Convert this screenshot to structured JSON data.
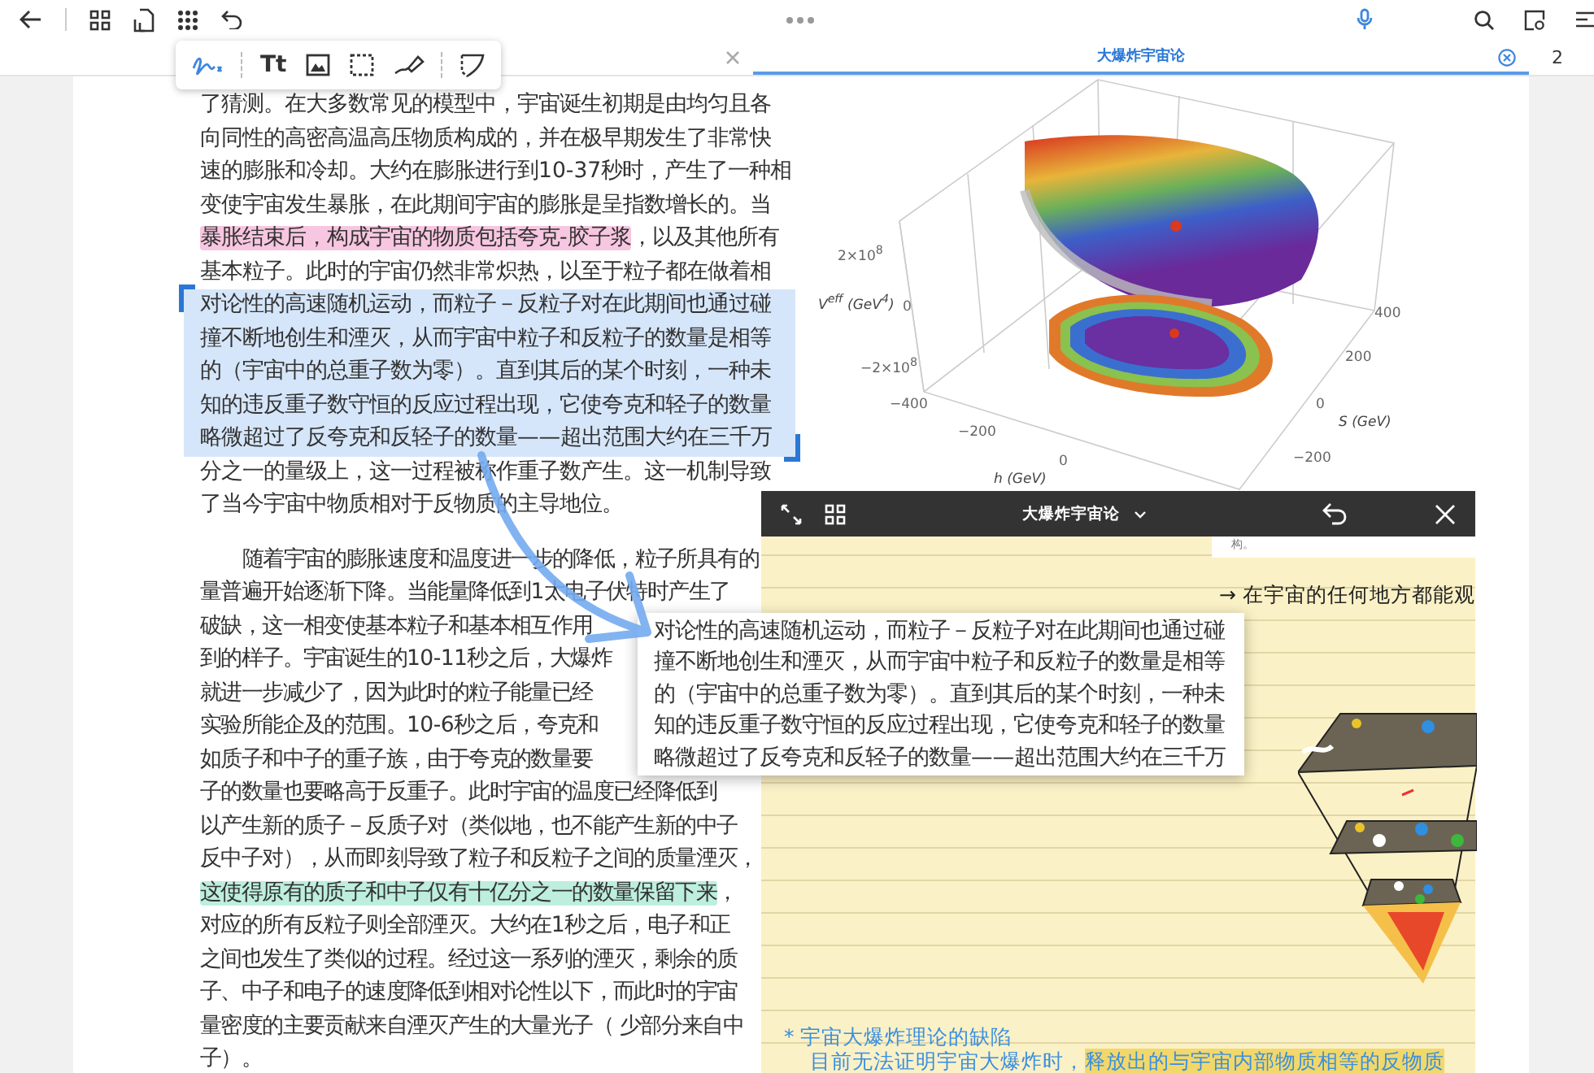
{
  "tabs": [
    {
      "label": "大爆炸宇宙论",
      "selected": true
    }
  ],
  "page_count": "2",
  "drawing_tools": [
    {
      "kind": "pen",
      "selected": true
    },
    {
      "kind": "text",
      "label": "Tt",
      "selected": false
    },
    {
      "kind": "image",
      "selected": false
    },
    {
      "kind": "select",
      "selected": false
    },
    {
      "kind": "highlighter",
      "selected": false
    },
    {
      "kind": "lasso",
      "selected": false
    }
  ],
  "document": {
    "paragraphs": [
      {
        "indent": false,
        "lines": [
          {
            "selected": false,
            "parts": [
              {
                "text": "了猜测。在大多数常见的模型中，宇宙诞生初期是由均匀且各"
              }
            ]
          },
          {
            "selected": false,
            "parts": [
              {
                "text": "向同性的高密高温高压物质构成的，并在极早期发生了非常快"
              }
            ]
          },
          {
            "selected": false,
            "parts": [
              {
                "text": "速的膨胀和冷却。大约在膨胀进行到10-37秒时，产生了一种相"
              }
            ]
          },
          {
            "selected": false,
            "parts": [
              {
                "text": "变使宇宙发生暴胀，在此期间宇宙的膨胀是呈指数增长的。当"
              }
            ]
          },
          {
            "selected": false,
            "parts": [
              {
                "text": "暴胀结束后，构成宇宙的物质包括夸克-胶子浆",
                "color": "#f7c6e0"
              },
              {
                "text": "，以及其他所有"
              }
            ]
          },
          {
            "selected": false,
            "parts": [
              {
                "text": "基本粒子。此时的宇宙仍然非常炽热，以至于粒子都在做着相"
              }
            ]
          },
          {
            "selected": true,
            "parts": [
              {
                "text": "对论性的高速随机运动，而粒子－反粒子对在此期间也通过碰"
              }
            ]
          },
          {
            "selected": true,
            "parts": [
              {
                "text": "撞不断地创生和湮灭，从而宇宙中粒子和反粒子的数量是相等"
              }
            ]
          },
          {
            "selected": true,
            "parts": [
              {
                "text": "的（宇宙中的总重子数为零）。直到其后的某个时刻，一种未"
              }
            ]
          },
          {
            "selected": true,
            "parts": [
              {
                "text": "知的违反重子数守恒的反应过程出现，它使夸克和轻子的数量"
              }
            ]
          },
          {
            "selected": true,
            "parts": [
              {
                "text": "略微超过了反夸克和反轻子的数量——超出范围大约在三千万"
              }
            ]
          },
          {
            "selected": false,
            "parts": [
              {
                "text": "分之一的量级上，这一过程被称作重子数产生。这一机制导致"
              }
            ]
          },
          {
            "selected": false,
            "parts": [
              {
                "text": "了当今宇宙中物质相对于反物质的主导地位。"
              }
            ]
          }
        ]
      },
      {
        "indent": true,
        "lines": [
          {
            "selected": false,
            "parts": [
              {
                "text": "随着宇宙的膨胀速度和温度进一步的降低，粒子所具有的"
              }
            ]
          },
          {
            "selected": false,
            "parts": [
              {
                "text": "量普遍开始逐渐下降。当能量降低到1太电子伏特时产生了"
              }
            ]
          },
          {
            "selected": false,
            "parts": [
              {
                "text": "破缺，这一相变使基本粒子和基本相互作用"
              }
            ]
          },
          {
            "selected": false,
            "parts": [
              {
                "text": "到的样子。宇宙诞生的10-11秒之后，大爆炸"
              }
            ]
          },
          {
            "selected": false,
            "parts": [
              {
                "text": "就进一步减少了，因为此时的粒子能量已经"
              }
            ]
          },
          {
            "selected": false,
            "parts": [
              {
                "text": "实验所能企及的范围。10-6秒之后，夸克和"
              }
            ]
          },
          {
            "selected": false,
            "parts": [
              {
                "text": "如质子和中子的重子族，由于夸克的数量要"
              }
            ]
          },
          {
            "selected": false,
            "parts": [
              {
                "text": "子的数量也要略高于反重子。此时宇宙的温度已经降低到"
              }
            ]
          },
          {
            "selected": false,
            "parts": [
              {
                "text": "以产生新的质子－反质子对（类似地，也不能产生新的中子"
              }
            ]
          },
          {
            "selected": false,
            "parts": [
              {
                "text": "反中子对），从而即刻导致了粒子和反粒子之间的质量湮灭，"
              }
            ]
          },
          {
            "selected": false,
            "parts": [
              {
                "text": "这使得原有的质子和中子仅有十亿分之一的数量保留下来",
                "color": "#bdeede"
              },
              {
                "text": "，"
              }
            ]
          },
          {
            "selected": false,
            "parts": [
              {
                "text": "对应的所有反粒子则全部湮灭。大约在1秒之后，电子和正"
              }
            ]
          },
          {
            "selected": false,
            "parts": [
              {
                "text": "之间也发生了类似的过程。经过这一系列的湮灭，剩余的质"
              }
            ]
          },
          {
            "selected": false,
            "parts": [
              {
                "text": "子、中子和电子的速度降低到相对论性以下，而此时的宇宙"
              }
            ]
          },
          {
            "selected": false,
            "parts": [
              {
                "text": "量密度的主要贡献来自湮灭产生的大量光子（ 少部分来自中"
              }
            ]
          },
          {
            "selected": false,
            "parts": [
              {
                "text": "子）。"
              }
            ]
          }
        ]
      }
    ]
  },
  "figure": {
    "labels": [
      {
        "kind": "tick",
        "text": "2×10$^{8}$"
      },
      {
        "kind": "axis",
        "text": "V$^{eff}$ (GeV$^{4}$)"
      },
      {
        "kind": "tick",
        "text": "0"
      },
      {
        "kind": "tick",
        "text": "−2×10$^{8}$"
      },
      {
        "kind": "tick",
        "text": "−400"
      },
      {
        "kind": "tick",
        "text": "−200"
      },
      {
        "kind": "tick",
        "text": "0"
      },
      {
        "kind": "axis",
        "text": "h (GeV)"
      },
      {
        "kind": "tick",
        "text": "400"
      },
      {
        "kind": "tick",
        "text": "200"
      },
      {
        "kind": "tick",
        "text": "0"
      },
      {
        "kind": "axis",
        "text": "S (GeV)"
      },
      {
        "kind": "tick",
        "text": "−200"
      }
    ]
  },
  "popup": {
    "lines": [
      "对论性的高速随机运动，而粒子－反粒子对在此期间也通过碰",
      "撞不断地创生和湮灭，从而宇宙中粒子和反粒子的数量是相等",
      "的（宇宙中的总重子数为零）。直到其后的某个时刻，一种未",
      "知的违反重子数守恒的反应过程出现，它使夸克和轻子的数量",
      "略微超过了反夸克和反轻子的数量——超出范围大约在三千万"
    ]
  },
  "note_window": {
    "title": "大爆炸宇宙论",
    "snippet": "构。",
    "side_note": "→ 在宇宙的任何地方都能观",
    "notes": [
      {
        "kind": "heading",
        "parts": [
          {
            "text": "* 宇宙大爆炸理论的缺陷"
          }
        ]
      },
      {
        "kind": "body",
        "parts": [
          {
            "text": "目前无法证明宇宙大爆炸时，"
          },
          {
            "text": "释放出的与宇宙内部物质相等的反物质",
            "color": "#f2d86a"
          }
        ]
      }
    ]
  }
}
